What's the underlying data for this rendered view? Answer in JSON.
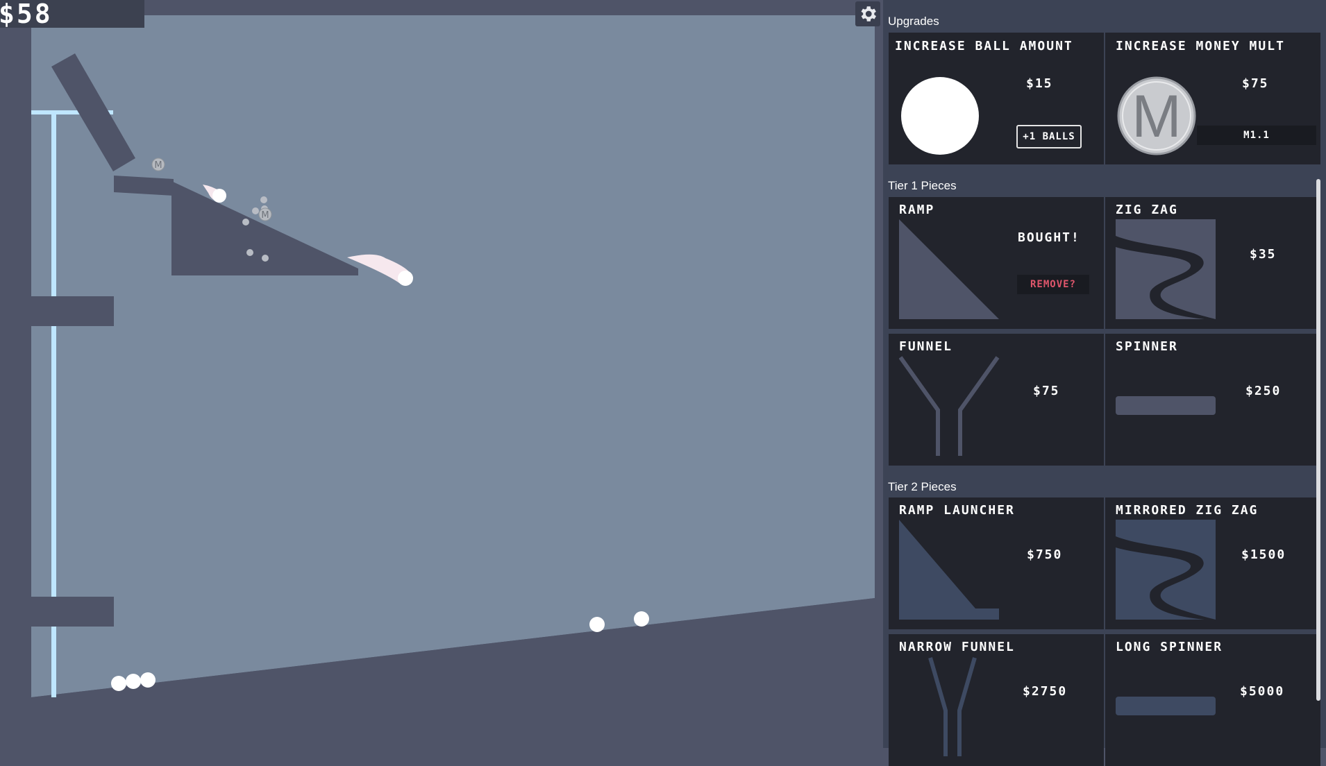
{
  "money": "$58",
  "icons": {
    "settings": "gear-icon"
  },
  "colors": {
    "background": "#4f5468",
    "sky": "#7a8a9e",
    "structure": "#4f5468",
    "panel": "#3c4355",
    "card": "#22242c",
    "remove_red": "#e0566c",
    "rail": "#bfe6ff"
  },
  "board_labels": {
    "m1": "M",
    "m2": "M"
  },
  "panel": {
    "sections": [
      {
        "title": "Upgrades",
        "cards": [
          {
            "name": "INCREASE BALL AMOUNT",
            "price": "$15",
            "badge": "+1 BALLS"
          },
          {
            "name": "INCREASE MONEY MULT",
            "price": "$75",
            "badge": "M1.1",
            "icon_letter": "M"
          }
        ]
      },
      {
        "title": "Tier 1 Pieces",
        "cards": [
          {
            "name": "RAMP",
            "status": "BOUGHT!",
            "remove_label": "REMOVE?"
          },
          {
            "name": "ZIG ZAG",
            "price": "$35"
          },
          {
            "name": "FUNNEL",
            "price": "$75"
          },
          {
            "name": "SPINNER",
            "price": "$250"
          }
        ]
      },
      {
        "title": "Tier 2 Pieces",
        "cards": [
          {
            "name": "RAMP LAUNCHER",
            "price": "$750"
          },
          {
            "name": "MIRRORED ZIG ZAG",
            "price": "$1500"
          },
          {
            "name": "NARROW FUNNEL",
            "price": "$2750"
          },
          {
            "name": "LONG SPINNER",
            "price": "$5000"
          }
        ]
      }
    ]
  }
}
